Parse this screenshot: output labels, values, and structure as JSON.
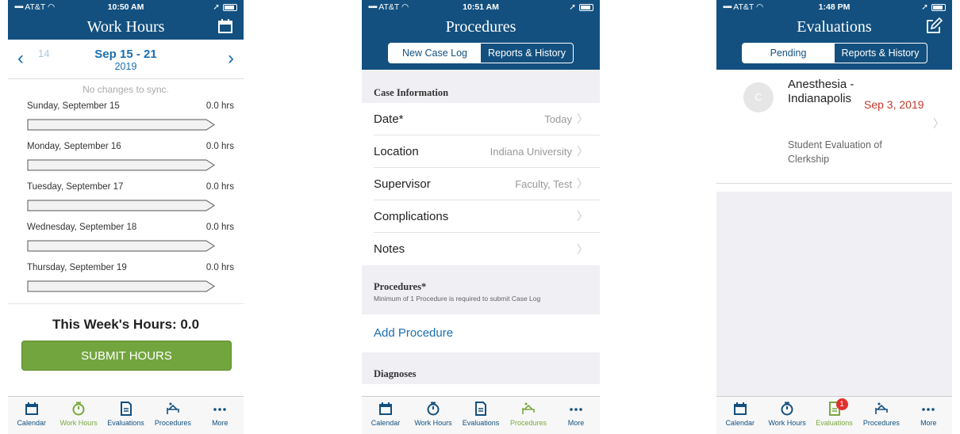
{
  "colors": {
    "header": "#13507f",
    "accent": "#1a6fb0",
    "active_tab": "#7aa83f",
    "submit": "#73a53f",
    "date_red": "#c0392b"
  },
  "tabs": [
    "Calendar",
    "Work Hours",
    "Evaluations",
    "Procedures",
    "More"
  ],
  "workhours": {
    "status": {
      "carrier": "AT&T",
      "time": "10:50 AM"
    },
    "title": "Work Hours",
    "header_icon": "calendar-icon",
    "prev_ghost": "14",
    "range": "Sep 15 - 21",
    "year": "2019",
    "sync_text": "No changes to sync.",
    "days": [
      {
        "label": "Sunday, September 15",
        "hours": "0.0 hrs"
      },
      {
        "label": "Monday, September 16",
        "hours": "0.0 hrs"
      },
      {
        "label": "Tuesday, September 17",
        "hours": "0.0 hrs"
      },
      {
        "label": "Wednesday, September 18",
        "hours": "0.0 hrs"
      },
      {
        "label": "Thursday, September 19",
        "hours": "0.0 hrs"
      }
    ],
    "week_total": "This Week's Hours: 0.0",
    "submit_label": "SUBMIT HOURS",
    "active_tab": "Work Hours"
  },
  "procedures": {
    "status": {
      "carrier": "AT&T",
      "time": "10:51 AM"
    },
    "title": "Procedures",
    "segments": [
      "New Case Log",
      "Reports & History"
    ],
    "case_info_header": "Case Information",
    "rows": [
      {
        "label": "Date*",
        "value": "Today"
      },
      {
        "label": "Location",
        "value": "Indiana University"
      },
      {
        "label": "Supervisor",
        "value": "Faculty, Test"
      },
      {
        "label": "Complications",
        "value": ""
      },
      {
        "label": "Notes",
        "value": ""
      }
    ],
    "procedures_header": "Procedures*",
    "procedures_sub": "Minimum of 1 Procedure is required to submit Case Log",
    "add_procedure": "Add Procedure",
    "diagnoses_header": "Diagnoses",
    "active_tab": "Procedures"
  },
  "evaluations": {
    "status": {
      "carrier": "AT&T",
      "time": "1:48 PM"
    },
    "title": "Evaluations",
    "header_icon": "compose-icon",
    "segments": [
      "Pending",
      "Reports & History"
    ],
    "item": {
      "avatar": "C",
      "name": "Anesthesia - Indianapolis",
      "date": "Sep 3, 2019",
      "subtitle": "Student Evaluation of Clerkship"
    },
    "badge": "1",
    "active_tab": "Evaluations"
  }
}
